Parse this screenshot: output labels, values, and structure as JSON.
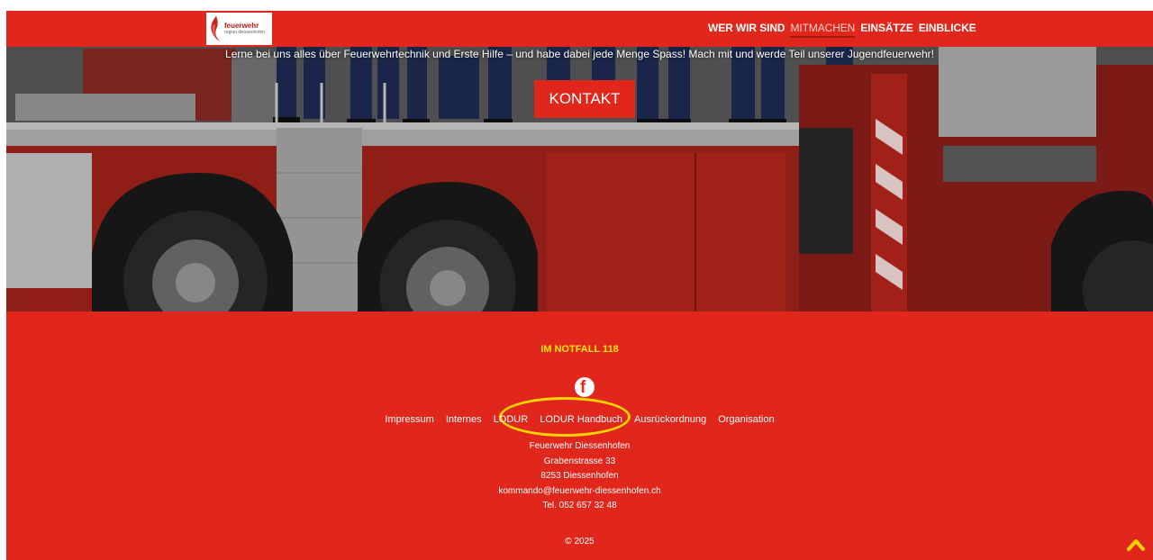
{
  "header": {
    "logo": {
      "line1": "feuerwehr",
      "line2": "region diessenhofen"
    },
    "nav": [
      {
        "label": "WER WIR SIND",
        "active": false
      },
      {
        "label": "MITMACHEN",
        "active": true
      },
      {
        "label": "EINSÄTZE",
        "active": false
      },
      {
        "label": "EINBLICKE",
        "active": false
      }
    ]
  },
  "hero": {
    "tagline": "Lerne bei uns alles über Feuerwehrtechnik und Erste Hilfe – und habe dabei jede Menge Spass! Mach mit und werde Teil unserer Jugendfeuerwehr!",
    "button_label": "KONTAKT"
  },
  "footer": {
    "emergency": "IM NOTFALL 118",
    "social_icon": "facebook-icon",
    "links": [
      "Impressum",
      "Internes",
      "LODUR",
      "LODUR Handbuch",
      "Ausrückordnung",
      "Organisation"
    ],
    "address": {
      "name": "Feuerwehr Diessenhofen",
      "street": "Grabenstrasse 33",
      "city": "8253 Diessenhofen",
      "email": "kommando@feuerwehr-diessenhofen.ch",
      "phone": "Tel. 052 657 32 48"
    },
    "copyright": "© 2025",
    "scroll_top_icon": "chevron-up-icon"
  },
  "colors": {
    "brand_red": "#e1261c",
    "emergency_yellow": "#ffe600",
    "highlight_circle": "#ffd200"
  }
}
